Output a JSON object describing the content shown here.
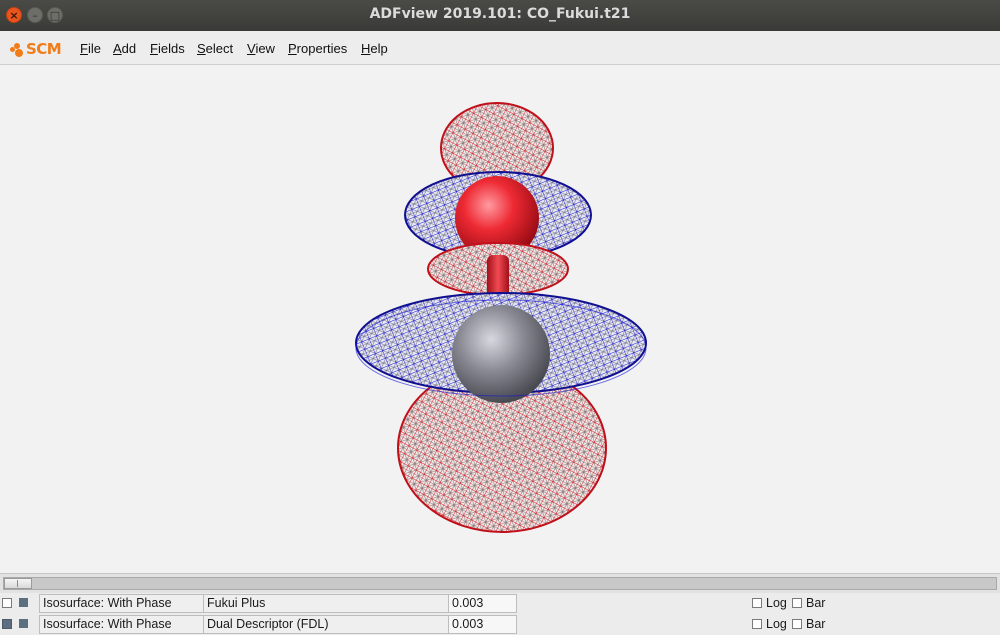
{
  "window": {
    "title": "ADFview 2019.101: CO_Fukui.t21",
    "close_glyph": "×",
    "minimize_glyph": "–",
    "maximize_glyph": "□"
  },
  "logo": {
    "text": "SCM"
  },
  "menu": [
    {
      "label": "File",
      "mnemonic": "F",
      "rest": "ile"
    },
    {
      "label": "Add",
      "mnemonic": "A",
      "rest": "dd"
    },
    {
      "label": "Fields",
      "mnemonic": "F",
      "rest": "ields"
    },
    {
      "label": "Select",
      "mnemonic": "S",
      "rest": "elect"
    },
    {
      "label": "View",
      "mnemonic": "V",
      "rest": "iew"
    },
    {
      "label": "Properties",
      "mnemonic": "P",
      "rest": "roperties"
    },
    {
      "label": "Help",
      "mnemonic": "H",
      "rest": "elp"
    }
  ],
  "colors": {
    "positive_phase": "#e0141e",
    "negative_phase": "#1414d8",
    "oxygen_atom": "#e8202a",
    "carbon_atom": "#7e7e7e",
    "accent": "#f07c1a"
  },
  "slider": {
    "position": 0
  },
  "fields": [
    {
      "visible": false,
      "selected": true,
      "type": "Isosurface: With Phase",
      "field": "Fukui Plus",
      "value": "0.003",
      "log_label": "Log",
      "log": false,
      "bar_label": "Bar",
      "bar": false
    },
    {
      "visible": true,
      "selected": true,
      "type": "Isosurface: With Phase",
      "field": "Dual Descriptor (FDL)",
      "value": "0.003",
      "log_label": "Log",
      "log": false,
      "bar_label": "Bar",
      "bar": false
    }
  ]
}
